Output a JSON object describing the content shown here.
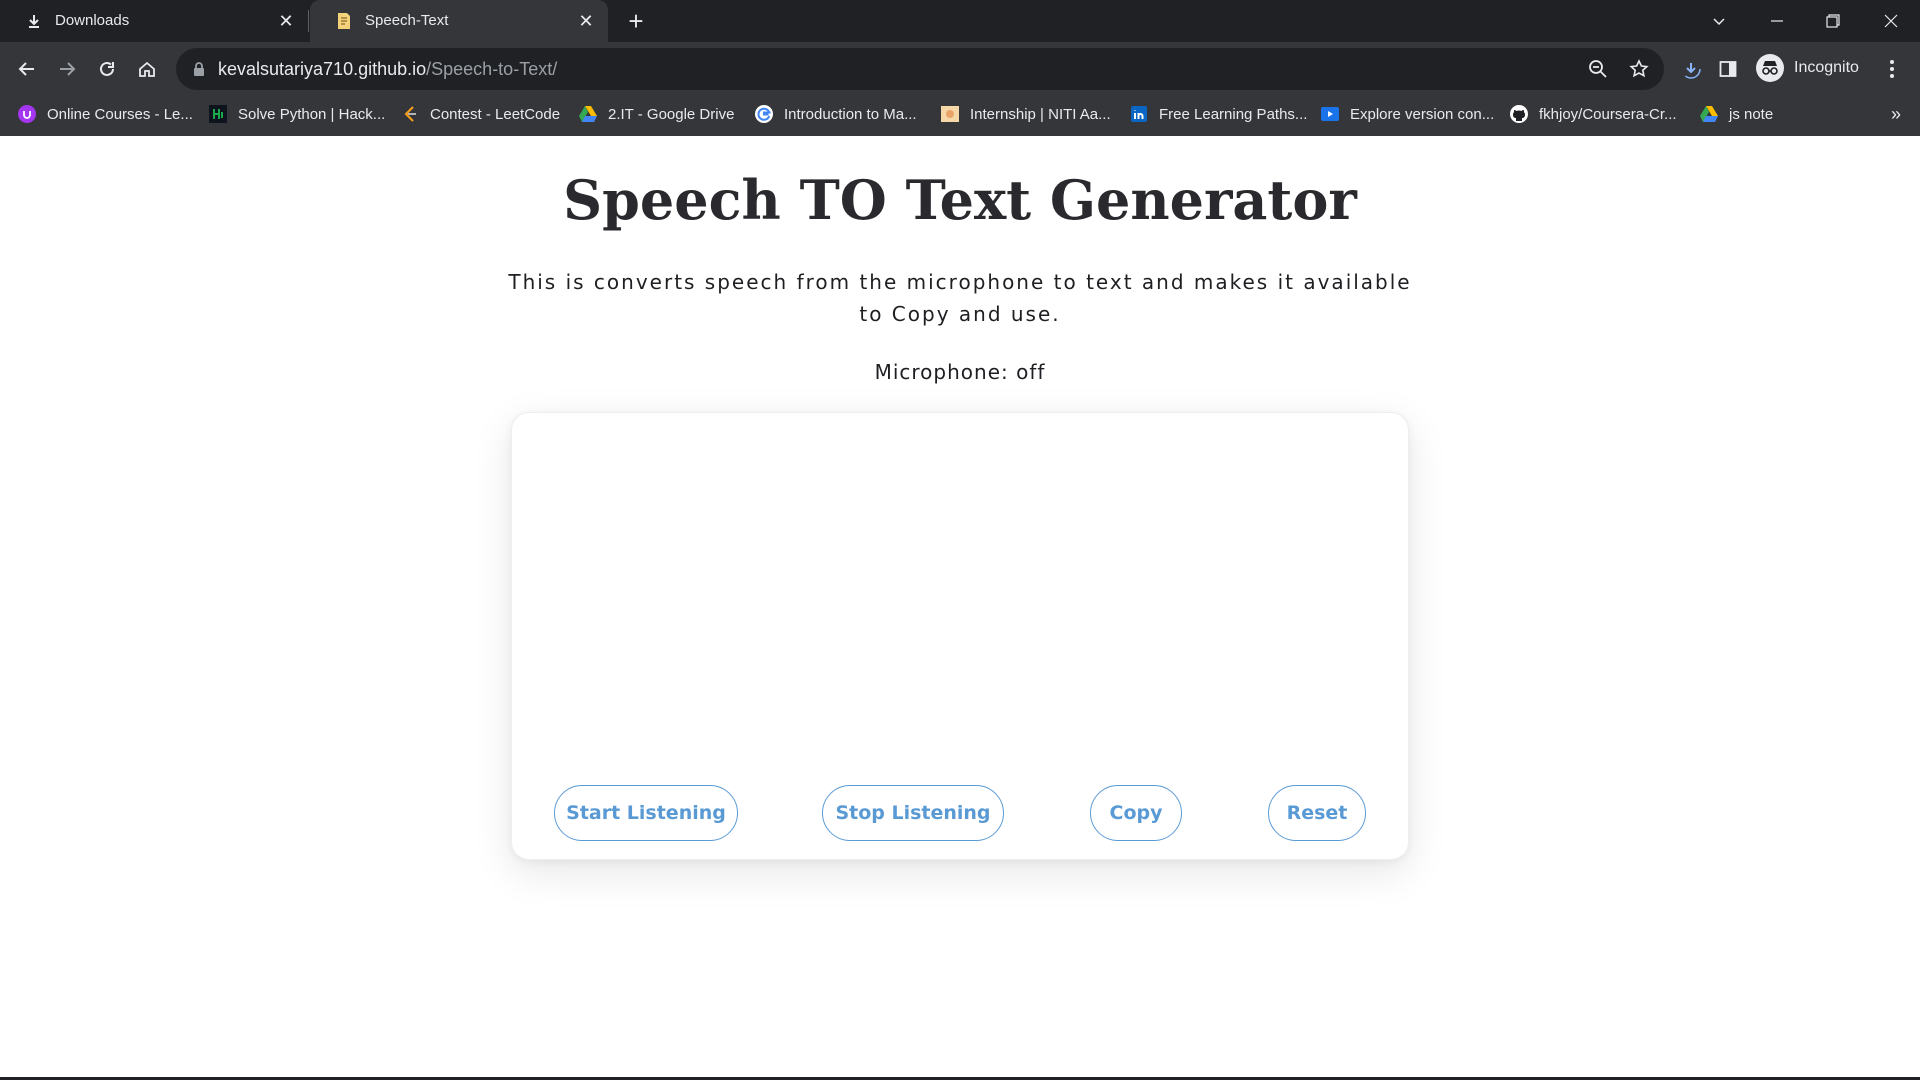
{
  "browser": {
    "tabs": [
      {
        "title": "Downloads",
        "icon": "download-icon"
      },
      {
        "title": "Speech-Text",
        "icon": "page-favicon-icon"
      }
    ],
    "url": {
      "domain": "kevalsutariya710.github.io",
      "path": "/Speech-to-Text/"
    },
    "profile_label": "Incognito",
    "bookmarks": [
      {
        "label": "Online Courses - Le...",
        "icon": "udemy-icon",
        "color": "#a435f0"
      },
      {
        "label": "Solve Python | Hack...",
        "icon": "hackerrank-icon",
        "color": "#000000"
      },
      {
        "label": "Contest - LeetCode",
        "icon": "leetcode-icon",
        "color": "#ffa116"
      },
      {
        "label": "2.IT - Google Drive",
        "icon": "google-drive-icon",
        "color": "#34a853"
      },
      {
        "label": "Introduction to Ma...",
        "icon": "google-icon",
        "color": "#ffffff"
      },
      {
        "label": "Internship | NITI Aa...",
        "icon": "niti-icon",
        "color": "#f6d8a8"
      },
      {
        "label": "Free Learning Paths...",
        "icon": "linkedin-icon",
        "color": "#0a66c2"
      },
      {
        "label": "Explore version con...",
        "icon": "video-icon",
        "color": "#1a73e8"
      },
      {
        "label": "fkhjoy/Coursera-Cr...",
        "icon": "github-icon",
        "color": "#ffffff"
      },
      {
        "label": "js note",
        "icon": "google-drive-icon",
        "color": "#34a853"
      }
    ]
  },
  "page": {
    "title": "Speech TO Text Generator",
    "description": "This is converts speech from the microphone to text and makes it available to Copy and use.",
    "mic_status": "Microphone: off",
    "transcript": "",
    "buttons": {
      "start": "Start Listening",
      "stop": "Stop Listening",
      "copy": "Copy",
      "reset": "Reset"
    },
    "accent_color": "#5a9ad4"
  }
}
